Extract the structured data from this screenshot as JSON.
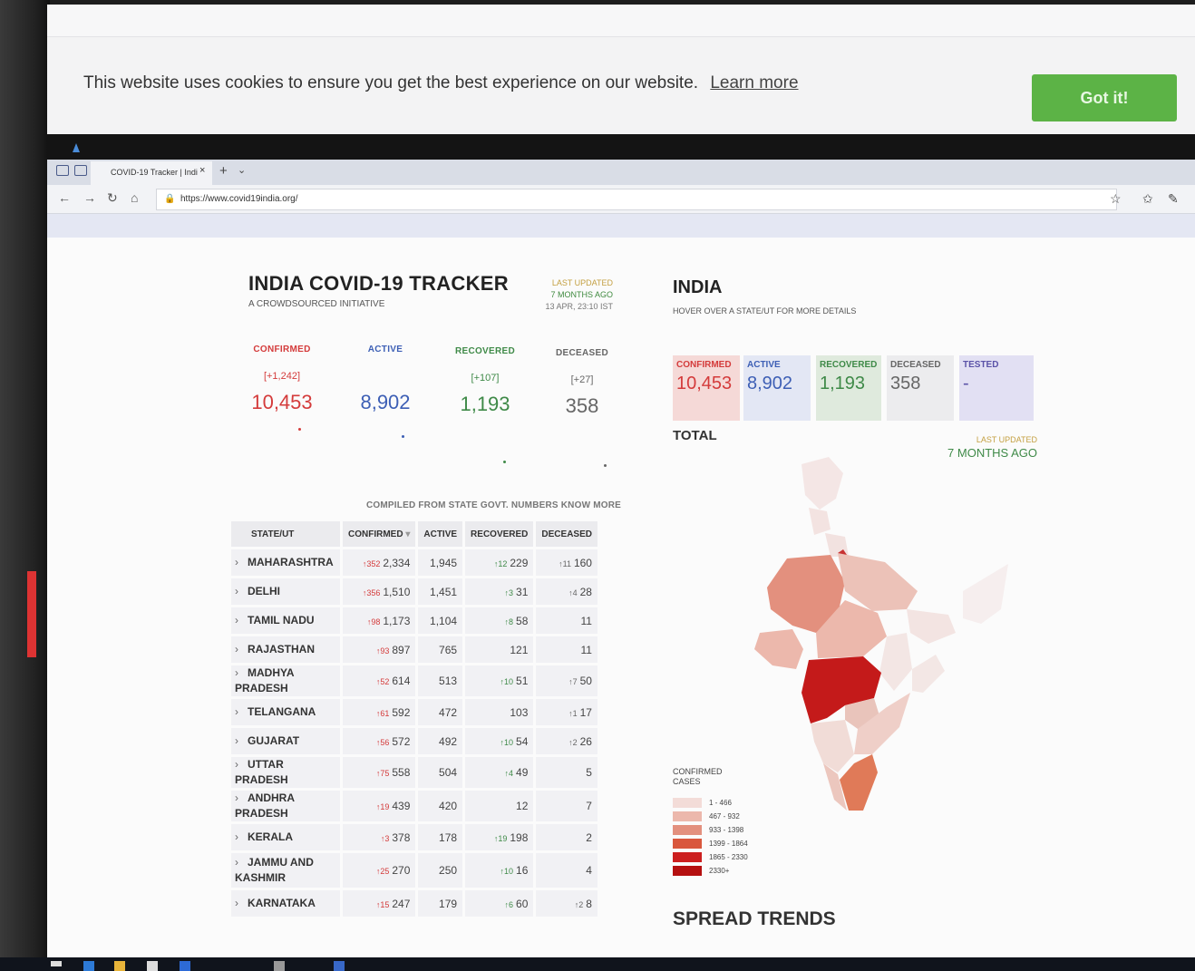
{
  "cookie": {
    "message": "This website uses cookies to ensure you get the best experience on our website.",
    "learn_more": "Learn more",
    "button": "Got it!"
  },
  "browser": {
    "tab_title": "COVID-19 Tracker | Indi",
    "tab_close": "×",
    "tab_new": "+",
    "url": "https://www.covid19india.org/"
  },
  "header": {
    "title": "INDIA COVID-19 TRACKER",
    "subtitle": "A CROWDSOURCED INITIATIVE",
    "last_updated_label": "LAST UPDATED",
    "last_updated_ago": "7 MONTHS AGO",
    "last_updated_time": "13 APR, 23:10 IST"
  },
  "stats": [
    {
      "label": "CONFIRMED",
      "delta": "[+1,242]",
      "value": "10,453",
      "color": "#d43b3b"
    },
    {
      "label": "ACTIVE",
      "delta": "",
      "value": "8,902",
      "color": "#3d5fb5"
    },
    {
      "label": "RECOVERED",
      "delta": "[+107]",
      "value": "1,193",
      "color": "#3f8a48"
    },
    {
      "label": "DECEASED",
      "delta": "[+27]",
      "value": "358",
      "color": "#666666"
    }
  ],
  "compiled_note": "COMPILED FROM STATE GOVT. NUMBERS KNOW MORE",
  "table": {
    "headers": {
      "state": "STATE/UT",
      "confirmed": "CONFIRMED",
      "active": "ACTIVE",
      "recovered": "RECOVERED",
      "deceased": "DECEASED"
    },
    "rows": [
      {
        "name": "MAHARASHTRA",
        "c_delta": "↑352",
        "confirmed": "2,334",
        "active": "1,945",
        "r_delta": "↑12",
        "recovered": "229",
        "d_delta": "↑11",
        "deceased": "160"
      },
      {
        "name": "DELHI",
        "c_delta": "↑356",
        "confirmed": "1,510",
        "active": "1,451",
        "r_delta": "↑3",
        "recovered": "31",
        "d_delta": "↑4",
        "deceased": "28"
      },
      {
        "name": "TAMIL NADU",
        "c_delta": "↑98",
        "confirmed": "1,173",
        "active": "1,104",
        "r_delta": "↑8",
        "recovered": "58",
        "d_delta": "",
        "deceased": "11"
      },
      {
        "name": "RAJASTHAN",
        "c_delta": "↑93",
        "confirmed": "897",
        "active": "765",
        "r_delta": "",
        "recovered": "121",
        "d_delta": "",
        "deceased": "11"
      },
      {
        "name": "MADHYA PRADESH",
        "c_delta": "↑52",
        "confirmed": "614",
        "active": "513",
        "r_delta": "↑10",
        "recovered": "51",
        "d_delta": "↑7",
        "deceased": "50"
      },
      {
        "name": "TELANGANA",
        "c_delta": "↑61",
        "confirmed": "592",
        "active": "472",
        "r_delta": "",
        "recovered": "103",
        "d_delta": "↑1",
        "deceased": "17"
      },
      {
        "name": "GUJARAT",
        "c_delta": "↑56",
        "confirmed": "572",
        "active": "492",
        "r_delta": "↑10",
        "recovered": "54",
        "d_delta": "↑2",
        "deceased": "26"
      },
      {
        "name": "UTTAR PRADESH",
        "c_delta": "↑75",
        "confirmed": "558",
        "active": "504",
        "r_delta": "↑4",
        "recovered": "49",
        "d_delta": "",
        "deceased": "5"
      },
      {
        "name": "ANDHRA PRADESH",
        "c_delta": "↑19",
        "confirmed": "439",
        "active": "420",
        "r_delta": "",
        "recovered": "12",
        "d_delta": "",
        "deceased": "7"
      },
      {
        "name": "KERALA",
        "c_delta": "↑3",
        "confirmed": "378",
        "active": "178",
        "r_delta": "↑19",
        "recovered": "198",
        "d_delta": "",
        "deceased": "2"
      },
      {
        "name": "JAMMU AND KASHMIR",
        "c_delta": "↑25",
        "confirmed": "270",
        "active": "250",
        "r_delta": "↑10",
        "recovered": "16",
        "d_delta": "",
        "deceased": "4"
      },
      {
        "name": "KARNATAKA",
        "c_delta": "↑15",
        "confirmed": "247",
        "active": "179",
        "r_delta": "↑6",
        "recovered": "60",
        "d_delta": "↑2",
        "deceased": "8"
      }
    ]
  },
  "india_panel": {
    "title": "INDIA",
    "subtitle": "HOVER OVER A STATE/UT FOR MORE DETAILS",
    "cards": [
      {
        "label": "CONFIRMED",
        "value": "10,453"
      },
      {
        "label": "ACTIVE",
        "value": "8,902"
      },
      {
        "label": "RECOVERED",
        "value": "1,193"
      },
      {
        "label": "DECEASED",
        "value": "358"
      },
      {
        "label": "TESTED",
        "value": "-"
      }
    ],
    "total_label": "TOTAL",
    "last_updated_label": "LAST UPDATED",
    "last_updated_ago": "7 MONTHS AGO",
    "legend_title": "CONFIRMED CASES",
    "legend": [
      {
        "range": "1 - 466",
        "color": "#f3dcd8"
      },
      {
        "range": "467 - 932",
        "color": "#ecb8ac"
      },
      {
        "range": "933 - 1398",
        "color": "#e3907e"
      },
      {
        "range": "1399 - 1864",
        "color": "#d9573d"
      },
      {
        "range": "1865 - 2330",
        "color": "#cc1f1f"
      },
      {
        "range": "2330+",
        "color": "#b51010"
      }
    ],
    "spread_title": "SPREAD TRENDS"
  },
  "colors": {
    "confirmed": "#d43b3b",
    "active": "#3d5fb5",
    "recovered": "#3f8a48",
    "deceased": "#666666",
    "got_it_green": "#5cb346"
  }
}
